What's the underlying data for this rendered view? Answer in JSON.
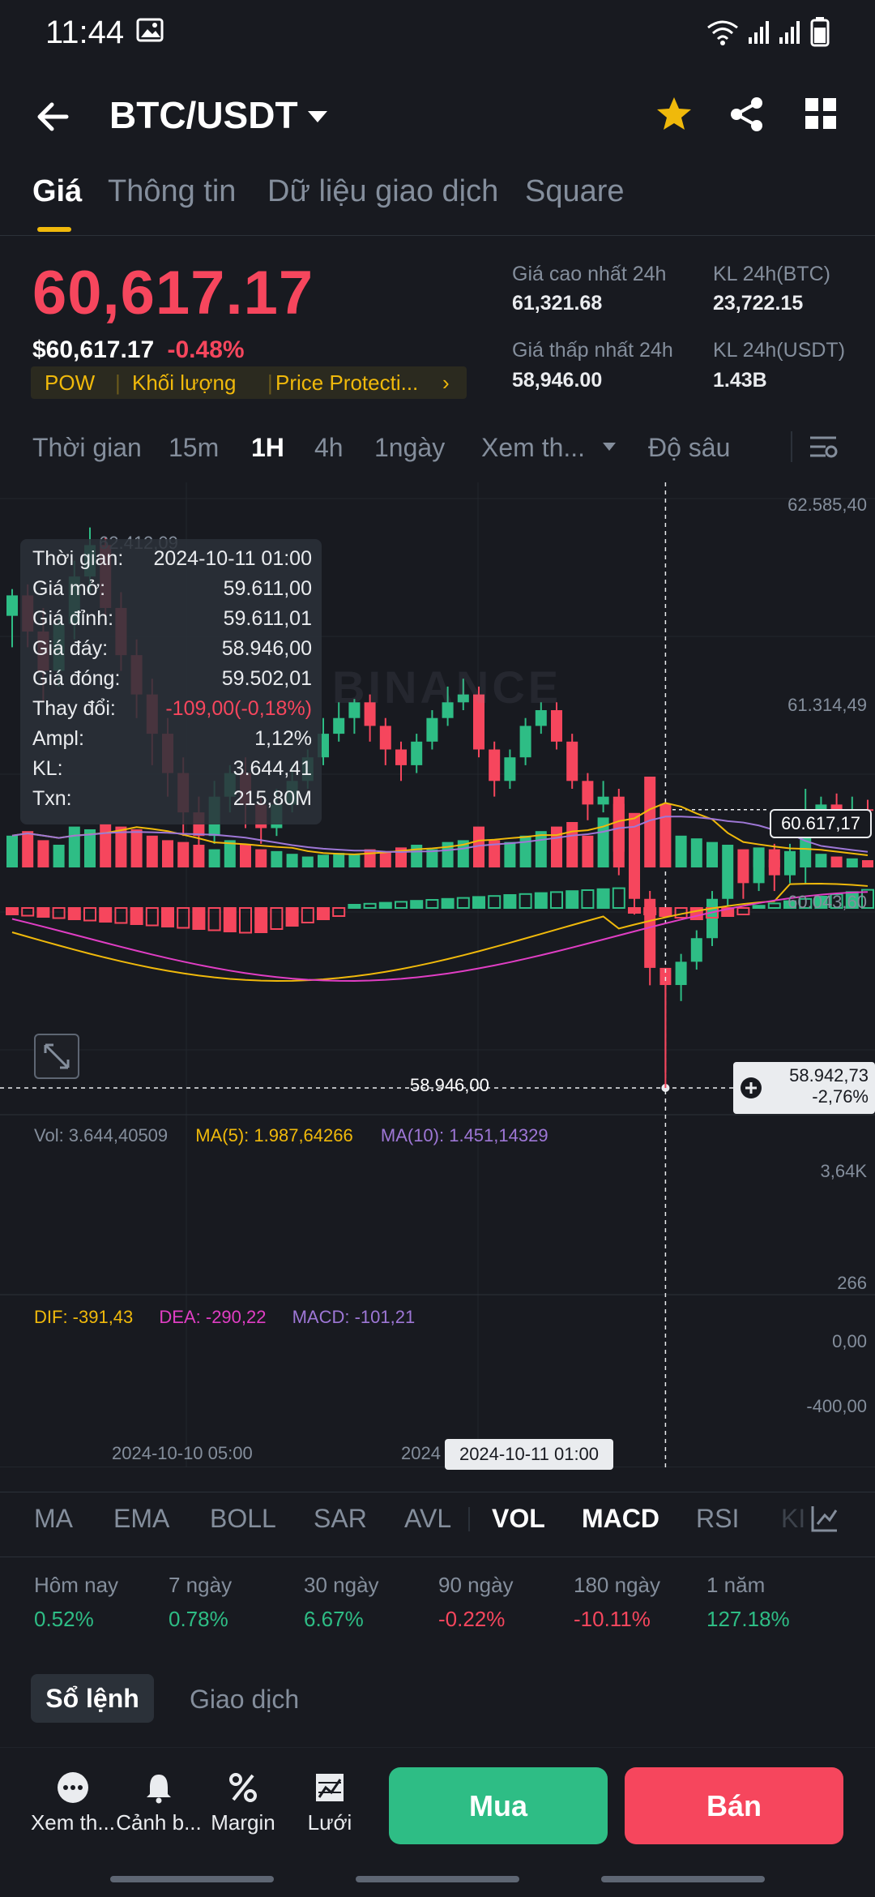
{
  "status_bar": {
    "time": "11:44"
  },
  "header": {
    "pair": "BTC/USDT"
  },
  "tabs": [
    "Giá",
    "Thông tin",
    "Dữ liệu giao dịch",
    "Square"
  ],
  "price": {
    "last": "60,617.17",
    "usd": "$60,617.17",
    "change_pct": "-0.48%",
    "tags": [
      "POW",
      "Khối lượng",
      "Price Protecti..."
    ],
    "high_label": "Giá cao nhất 24h",
    "high_value": "61,321.68",
    "vol_btc_label": "KL 24h(BTC)",
    "vol_btc_value": "23,722.15",
    "low_label": "Giá thấp nhất 24h",
    "low_value": "58,946.00",
    "vol_usdt_label": "KL 24h(USDT)",
    "vol_usdt_value": "1.43B"
  },
  "timeframes": {
    "items": [
      "Thời gian",
      "15m",
      "1H",
      "4h",
      "1ngày",
      "Xem th...",
      "Độ sâu"
    ],
    "active": "1H"
  },
  "chart": {
    "axis_labels": [
      "62.585,40",
      "61.314,49",
      "60.043,60"
    ],
    "current_price_tag": "60.617,17",
    "high_marker": "62.412,09",
    "low_marker": "58.946,00",
    "crosshair_price": "58.942,73",
    "crosshair_pct": "-2,76%",
    "watermark": "BINANCE",
    "tooltip": [
      {
        "k": "Thời gian:",
        "v": "2024-10-11 01:00",
        "color": "#eaecef"
      },
      {
        "k": "Giá mở:",
        "v": "59.611,00",
        "color": "#eaecef"
      },
      {
        "k": "Giá đỉnh:",
        "v": "59.611,01",
        "color": "#eaecef"
      },
      {
        "k": "Giá đáy:",
        "v": "58.946,00",
        "color": "#eaecef"
      },
      {
        "k": "Giá đóng:",
        "v": "59.502,01",
        "color": "#eaecef"
      },
      {
        "k": "Thay đổi:",
        "v": "-109,00(-0,18%)",
        "color": "#f6465d"
      },
      {
        "k": "Ampl:",
        "v": "1,12%",
        "color": "#eaecef"
      },
      {
        "k": "KL:",
        "v": "3.644,41",
        "color": "#eaecef"
      },
      {
        "k": "Txn:",
        "v": "215,80M",
        "color": "#eaecef"
      }
    ],
    "vol_legend": {
      "vol": "Vol: 3.644,40509",
      "ma5": "MA(5): 1.987,64266",
      "ma10": "MA(10): 1.451,14329"
    },
    "vol_axis": [
      "3,64K",
      "266"
    ],
    "macd_legend": {
      "dif": "DIF: -391,43",
      "dea": "DEA: -290,22",
      "macd": "MACD: -101,21"
    },
    "macd_axis": [
      "0,00",
      "-400,00"
    ],
    "x_labels": [
      "2024-10-10 05:00",
      "2024"
    ],
    "crosshair_time": "2024-10-11 01:00",
    "colors": {
      "up": "#2ebd85",
      "down": "#f6465d",
      "ma5": "#f0b90b",
      "ma10": "#9e77d6",
      "dif": "#f0b90b",
      "dea": "#e03ec4"
    }
  },
  "indicators": {
    "items": [
      "MA",
      "EMA",
      "BOLL",
      "SAR",
      "AVL",
      "VOL",
      "MACD",
      "RSI",
      "KI"
    ],
    "active": [
      "VOL",
      "MACD"
    ]
  },
  "performance": [
    {
      "label": "Hôm nay",
      "value": "0.52%",
      "dir": "up"
    },
    {
      "label": "7 ngày",
      "value": "0.78%",
      "dir": "up"
    },
    {
      "label": "30 ngày",
      "value": "6.67%",
      "dir": "up"
    },
    {
      "label": "90 ngày",
      "value": "-0.22%",
      "dir": "down"
    },
    {
      "label": "180 ngày",
      "value": "-10.11%",
      "dir": "down"
    },
    {
      "label": "1 năm",
      "value": "127.18%",
      "dir": "up"
    }
  ],
  "book_tabs": {
    "order_book": "Sổ lệnh",
    "trades": "Giao dịch"
  },
  "bottom_bar": {
    "more": "Xem th...",
    "alert": "Cảnh b...",
    "margin": "Margin",
    "grid": "Lưới",
    "buy": "Mua",
    "sell": "Bán"
  }
}
